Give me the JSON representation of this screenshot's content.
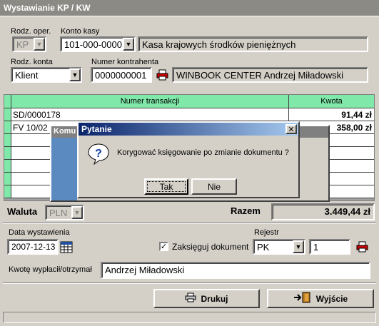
{
  "window": {
    "title": "Wystawianie KP / KW"
  },
  "form": {
    "rodz_oper": {
      "label": "Rodz. oper.",
      "value": "KP"
    },
    "konto_kasy": {
      "label": "Konto kasy",
      "value": "101-000-0000",
      "description": "Kasa krajowych środków pieniężnych"
    },
    "rodz_konta": {
      "label": "Rodz. konta",
      "value": "Klient"
    },
    "numer_kontrahenta": {
      "label": "Numer kontrahenta",
      "value": "0000000001",
      "name": "WINBOOK CENTER  Andrzej Miładowski"
    }
  },
  "grid": {
    "columns": [
      "Numer transakcji",
      "Kwota"
    ],
    "rows": [
      {
        "numer": "SD/0000178",
        "kwota": "91,44 zł"
      },
      {
        "numer": "FV 10/02",
        "kwota": "358,00 zł"
      }
    ]
  },
  "summary": {
    "waluta_label": "Waluta",
    "waluta_value": "PLN",
    "razem_label": "Razem",
    "razem_value": "3.449,44 zł"
  },
  "bottom": {
    "data_label": "Data wystawienia",
    "data_value": "2007-12-13",
    "zaksieguj_label": "Zaksięguj dokument",
    "zaksieguj_checked": "✓",
    "rejestr_label": "Rejestr",
    "rejestr_value": "PK",
    "rejestr_number": "1",
    "kwote_label": "Kwotę wypłacił/otrzymał",
    "kwote_value": "Andrzej Miładowski"
  },
  "buttons": {
    "drukuj": "Drukuj",
    "wyjscie": "Wyjście"
  },
  "background_window": {
    "title_fragment": "Komu"
  },
  "dialog": {
    "title": "Pytanie",
    "close": "✕",
    "message": "Korygować księgowanie po zmianie dokumentu ?",
    "yes": "Tak",
    "no": "Nie",
    "icon_glyph": "?"
  },
  "icons": {
    "printer": "printer-icon",
    "calendar": "calendar-icon",
    "question": "question-icon",
    "exit": "exit-door-icon"
  }
}
